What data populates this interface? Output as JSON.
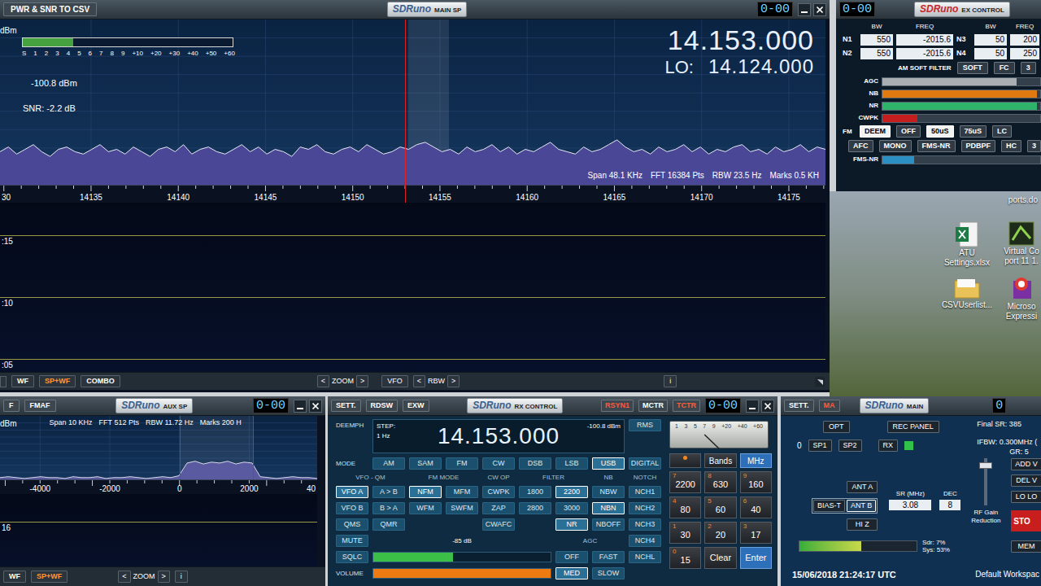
{
  "main_sp": {
    "title_button": "PWR & SNR TO CSV",
    "logo": "SDRuno",
    "title": "MAIN SP",
    "counter": "0-00",
    "unit": "dBm",
    "smeter": {
      "scale": [
        "S",
        "1",
        "2",
        "3",
        "4",
        "5",
        "6",
        "7",
        "8",
        "9",
        "+10",
        "+20",
        "+30",
        "+40",
        "+50",
        "+60"
      ],
      "level": 0.24
    },
    "power": "-100.8 dBm",
    "snr": "SNR: -2.2 dB",
    "frequency": "14.153.000",
    "lo_label": "LO:",
    "lo": "14.124.000",
    "info": [
      "Span 48.1 KHz",
      "FFT 16384 Pts",
      "RBW 23.5 Hz",
      "Marks 0.5 KH"
    ],
    "x_range": [
      14129.78,
      14177.1
    ],
    "y_range": [
      -130,
      -60
    ],
    "tuned": 14153,
    "passband": [
      14153.2,
      14155.5
    ],
    "ticks": [
      {
        "label": "30",
        "value": 14130,
        "kind": "edge"
      },
      {
        "label": "14135",
        "value": 14135,
        "kind": "tick"
      },
      {
        "label": "14140",
        "value": 14140,
        "kind": "tick"
      },
      {
        "label": "14145",
        "value": 14145,
        "kind": "tick"
      },
      {
        "label": "14150",
        "value": 14150,
        "kind": "tick"
      },
      {
        "label": "14155",
        "value": 14155,
        "kind": "tick"
      },
      {
        "label": "14160",
        "value": 14160,
        "kind": "tick"
      },
      {
        "label": "14165",
        "value": 14165,
        "kind": "tick"
      },
      {
        "label": "14170",
        "value": 14170,
        "kind": "tick"
      },
      {
        "label": "14175",
        "value": 14175,
        "kind": "tick"
      }
    ],
    "trace": [
      -116,
      -114,
      -117,
      -115,
      -113,
      -116,
      -118,
      -115,
      -114,
      -116,
      -117,
      -115,
      -113,
      -116,
      -115,
      -117,
      -114,
      -116,
      -118,
      -115,
      -114,
      -116,
      -113,
      -117,
      -115,
      -114,
      -116,
      -117,
      -115,
      -113,
      -116,
      -114,
      -117,
      -115,
      -116,
      -118,
      -114,
      -115,
      -113,
      -116,
      -117,
      -115,
      -114,
      -116,
      -113,
      -115,
      -117,
      -116,
      -114,
      -115,
      -113,
      -112,
      -114,
      -116,
      -115,
      -117,
      -114,
      -116,
      -115,
      -113,
      -116,
      -114,
      -117,
      -115,
      -116,
      -114,
      -112,
      -115,
      -116,
      -117,
      -114,
      -116,
      -115,
      -113,
      -111,
      -114,
      -116,
      -115,
      -117,
      -114,
      -116,
      -115,
      -113,
      -116,
      -114,
      -117,
      -115,
      -116,
      -114,
      -113,
      -116,
      -115,
      -117,
      -114,
      -116,
      -115,
      -113,
      -116,
      -114,
      -115
    ],
    "waterfall_times": [
      ":15",
      ":10",
      ":05"
    ],
    "toolbar": [
      {
        "label": "WF",
        "selected": false
      },
      {
        "label": "SP+WF",
        "selected": true
      },
      {
        "label": "COMBO",
        "selected": false
      }
    ],
    "zoom": {
      "prev": "<",
      "label": "ZOOM",
      "next": ">"
    },
    "vfo": "VFO",
    "rbw": {
      "prev": "<",
      "label": "RBW",
      "next": ">"
    },
    "info_button": "i"
  },
  "ex_control": {
    "counter": "0-00",
    "logo": "SDRuno",
    "title": "EX CONTROL",
    "columns": [
      "BW",
      "FREQ",
      "BW",
      "FREQ"
    ],
    "notch_pairs": [
      [
        {
          "label": "N1",
          "bw": "550",
          "freq": "-2015.6"
        },
        {
          "label": "N3",
          "bw": "50",
          "freq": "200"
        }
      ],
      [
        {
          "label": "N2",
          "bw": "550",
          "freq": "-2015.6"
        },
        {
          "label": "N4",
          "bw": "50",
          "freq": "250"
        }
      ]
    ],
    "am_soft_filter": "AM SOFT FILTER",
    "soft_buttons": [
      {
        "label": "SOFT",
        "selected": false
      },
      {
        "label": "FC",
        "selected": false
      },
      {
        "label": "3",
        "selected": false
      }
    ],
    "sliders": [
      {
        "label": "AGC",
        "level": 0.85,
        "color": "#a9aeb3"
      },
      {
        "label": "NB",
        "level": 0.98,
        "color": "#e07a10"
      },
      {
        "label": "NR",
        "level": 0.98,
        "color": "#2fb36a"
      },
      {
        "label": "CWPK",
        "level": 0.22,
        "color": "#c41e1e"
      }
    ],
    "fm_label": "FM",
    "fm_rows": [
      [
        {
          "label": "DEEM",
          "selected": true
        },
        {
          "label": "OFF",
          "selected": false
        },
        {
          "label": "50uS",
          "selected": true
        },
        {
          "label": "75uS",
          "selected": false
        },
        {
          "label": "LC",
          "selected": false
        }
      ],
      [
        {
          "label": "AFC",
          "selected": false
        },
        {
          "label": "MONO",
          "selected": false
        },
        {
          "label": "FMS-NR",
          "selected": false
        },
        {
          "label": "PDBPF",
          "selected": false
        },
        {
          "label": "HC",
          "selected": false
        },
        {
          "label": "3",
          "selected": false
        }
      ]
    ],
    "fms_nr": {
      "label": "FMS-NR",
      "level": 0.2,
      "color": "#2b8fc4"
    }
  },
  "desktop": {
    "top_label": "ports.do",
    "icons": [
      {
        "lines": [
          "ATU",
          "Settings.xlsx"
        ],
        "kind": "excel"
      },
      {
        "lines": [
          "Virtual Co",
          "port 11 1."
        ],
        "kind": "app"
      },
      {
        "lines": [
          "CSVUserlist..."
        ],
        "kind": "folder"
      },
      {
        "lines": [
          "Microso",
          "Expressi"
        ],
        "kind": "express"
      }
    ]
  },
  "aux_sp": {
    "f_button": "F",
    "fmaf_button": "FMAF",
    "logo": "SDRuno",
    "title": "AUX SP",
    "counter": "0-00",
    "unit": "dBm",
    "info": [
      "Span 10 KHz",
      "FFT 512 Pts",
      "RBW 11.72 Hz",
      "Marks 200 H"
    ],
    "x_range": [
      -5150,
      3950
    ],
    "y_range": [
      -130,
      -60
    ],
    "passband": [
      0,
      2100
    ],
    "ticks": [
      {
        "label": "-4000",
        "value": -4000,
        "kind": "tick"
      },
      {
        "label": "-2000",
        "value": -2000,
        "kind": "tick"
      },
      {
        "label": "0",
        "value": 0,
        "kind": "tick"
      },
      {
        "label": "2000",
        "value": 2000,
        "kind": "tick"
      },
      {
        "label": "40",
        "value": 4000,
        "kind": "edge"
      }
    ],
    "trace": [
      -128,
      -127,
      -128,
      -129,
      -128,
      -127,
      -128,
      -128,
      -129,
      -127,
      -128,
      -128,
      -127,
      -129,
      -128,
      -128,
      -127,
      -128,
      -129,
      -128,
      -127,
      -128,
      -126,
      -112,
      -110,
      -113,
      -111,
      -112,
      -110,
      -113,
      -111,
      -112,
      -127,
      -128,
      -129,
      -128,
      -127,
      -128,
      -128,
      -129
    ],
    "waterfall_time": "16",
    "toolbar": [
      {
        "label": "WF",
        "selected": false
      },
      {
        "label": "SP+WF",
        "selected": true
      }
    ],
    "zoom": {
      "prev": "<",
      "label": "ZOOM",
      "next": ">"
    },
    "info_button": "i"
  },
  "rx_control": {
    "title_buttons": [
      {
        "label": "SETT.",
        "selected": false
      },
      {
        "label": "RDSW",
        "selected": false
      },
      {
        "label": "EXW",
        "selected": false
      }
    ],
    "logo": "SDRuno",
    "title": "RX CONTROL",
    "sync_buttons": [
      {
        "label": "RSYN1",
        "selected": true
      },
      {
        "label": "MCTR",
        "selected": false
      },
      {
        "label": "TCTR",
        "selected": true
      }
    ],
    "counter": "0-00",
    "deemph": "DEEMPH",
    "step_label": "STEP:",
    "step": "1 Hz",
    "frequency": "14.153.000",
    "level": "-100.8 dBm",
    "rms": "RMS",
    "mode_label": "MODE",
    "modes": [
      {
        "label": "AM",
        "selected": false
      },
      {
        "label": "SAM",
        "selected": false
      },
      {
        "label": "FM",
        "selected": false
      },
      {
        "label": "CW",
        "selected": false
      },
      {
        "label": "DSB",
        "selected": false
      },
      {
        "label": "LSB",
        "selected": false
      },
      {
        "label": "USB",
        "selected": true
      },
      {
        "label": "DIGITAL",
        "selected": false
      }
    ],
    "headers": {
      "vfo": "VFO - QM",
      "fm": "FM MODE",
      "cw": "CW OP",
      "filter": "FILTER",
      "nb": "NB",
      "notch": "NOTCH"
    },
    "grid_rows": [
      [
        {
          "label": "VFO A",
          "selected": true,
          "kind": "button"
        },
        {
          "label": "A > B",
          "selected": false,
          "kind": "button"
        },
        {
          "label": "NFM",
          "selected": true,
          "kind": "button"
        },
        {
          "label": "MFM",
          "selected": false,
          "kind": "button"
        },
        {
          "label": "CWPK",
          "selected": false,
          "kind": "button"
        },
        {
          "label": "1800",
          "selected": false,
          "kind": "button"
        },
        {
          "label": "2200",
          "selected": true,
          "kind": "button"
        },
        {
          "label": "NBW",
          "selected": false,
          "kind": "button"
        },
        {
          "label": "NCH1",
          "selected": false,
          "kind": "button"
        }
      ],
      [
        {
          "label": "VFO B",
          "selected": false,
          "kind": "button"
        },
        {
          "label": "B > A",
          "selected": false,
          "kind": "button"
        },
        {
          "label": "WFM",
          "selected": false,
          "kind": "button"
        },
        {
          "label": "SWFM",
          "selected": false,
          "kind": "button"
        },
        {
          "label": "ZAP",
          "selected": false,
          "kind": "button"
        },
        {
          "label": "2800",
          "selected": false,
          "kind": "button"
        },
        {
          "label": "3000",
          "selected": false,
          "kind": "button"
        },
        {
          "label": "NBN",
          "selected": true,
          "kind": "button"
        },
        {
          "label": "NCH2",
          "selected": false,
          "kind": "button"
        }
      ],
      [
        {
          "label": "QMS",
          "selected": false,
          "kind": "button"
        },
        {
          "label": "QMR",
          "selected": false,
          "kind": "button"
        },
        {
          "kind": "empty"
        },
        {
          "kind": "empty"
        },
        {
          "label": "CWAFC",
          "selected": false,
          "kind": "button"
        },
        {
          "kind": "empty"
        },
        {
          "label": "NR",
          "selected": true,
          "kind": "button"
        },
        {
          "label": "NBOFF",
          "selected": false,
          "kind": "button"
        },
        {
          "label": "NCH3",
          "selected": false,
          "kind": "button"
        }
      ]
    ],
    "mute": {
      "label": "MUTE",
      "selected": false
    },
    "notch_extra": [
      {
        "label": "NCH4",
        "selected": false
      },
      {
        "label": "NCHL",
        "selected": false
      }
    ],
    "squelch": {
      "label": "SQLC",
      "reading": "-85 dB",
      "level": 0.45
    },
    "agc": {
      "label": "AGC",
      "options": [
        {
          "label": "OFF",
          "selected": false
        },
        {
          "label": "FAST",
          "selected": false
        },
        {
          "label": "MED",
          "selected": true
        },
        {
          "label": "SLOW",
          "selected": false
        }
      ]
    },
    "volume": {
      "label": "VOLUME",
      "level": 1.0
    },
    "smeter": {
      "scale": [
        "1",
        "3",
        "5",
        "7",
        "9",
        "+20",
        "+40",
        "+60"
      ],
      "level": 0.08
    },
    "keypad": {
      "top": [
        {
          "label": "Bands",
          "selected": false
        },
        {
          "label": "MHz",
          "selected": true
        }
      ],
      "keys": [
        {
          "digit": "7",
          "band": "2200"
        },
        {
          "digit": "8",
          "band": "630"
        },
        {
          "digit": "9",
          "band": "160"
        },
        {
          "digit": "4",
          "band": "80"
        },
        {
          "digit": "5",
          "band": "60"
        },
        {
          "digit": "6",
          "band": "40"
        },
        {
          "digit": "1",
          "band": "30"
        },
        {
          "digit": "2",
          "band": "20"
        },
        {
          "digit": "3",
          "band": "17"
        },
        {
          "digit": "0",
          "band": "15"
        }
      ],
      "clear": "Clear",
      "enter": "Enter"
    }
  },
  "main": {
    "sett": "SETT.",
    "ma": "MA",
    "logo": "SDRuno",
    "title": "MAIN",
    "counter": "0",
    "opt": "OPT",
    "rec_panel": "REC PANEL",
    "final_sr": "Final SR: 385",
    "index": "0",
    "sp_buttons": [
      {
        "label": "SP1",
        "selected": false
      },
      {
        "label": "SP2",
        "selected": false
      },
      {
        "label": "RX",
        "selected": false
      }
    ],
    "rx_on": true,
    "ifbw": "IFBW: 0.300MHz (",
    "gr": "GR: 5",
    "side_buttons": [
      {
        "label": "ADD V"
      },
      {
        "label": "DEL V"
      },
      {
        "label": "LO LO"
      }
    ],
    "antennas": [
      {
        "label": "ANT A",
        "selected": false
      },
      {
        "label": "BIAS-T",
        "selected": false
      },
      {
        "label": "ANT B",
        "selected": true
      },
      {
        "label": "HI Z",
        "selected": false
      }
    ],
    "sr_label": "SR (MHz)",
    "sr": "3.08",
    "dec_label": "DEC",
    "dec": "8",
    "rf_gain": {
      "label": "RF Gain Reduction",
      "level": 0.85
    },
    "stop": "STO",
    "mem": "MEM",
    "load": {
      "sdr": "Sdr: 7%",
      "sys": "Sys: 53%",
      "level": 0.53
    },
    "timestamp": "15/06/2018 21:24:17 UTC",
    "workspace": "Default Workspac"
  }
}
